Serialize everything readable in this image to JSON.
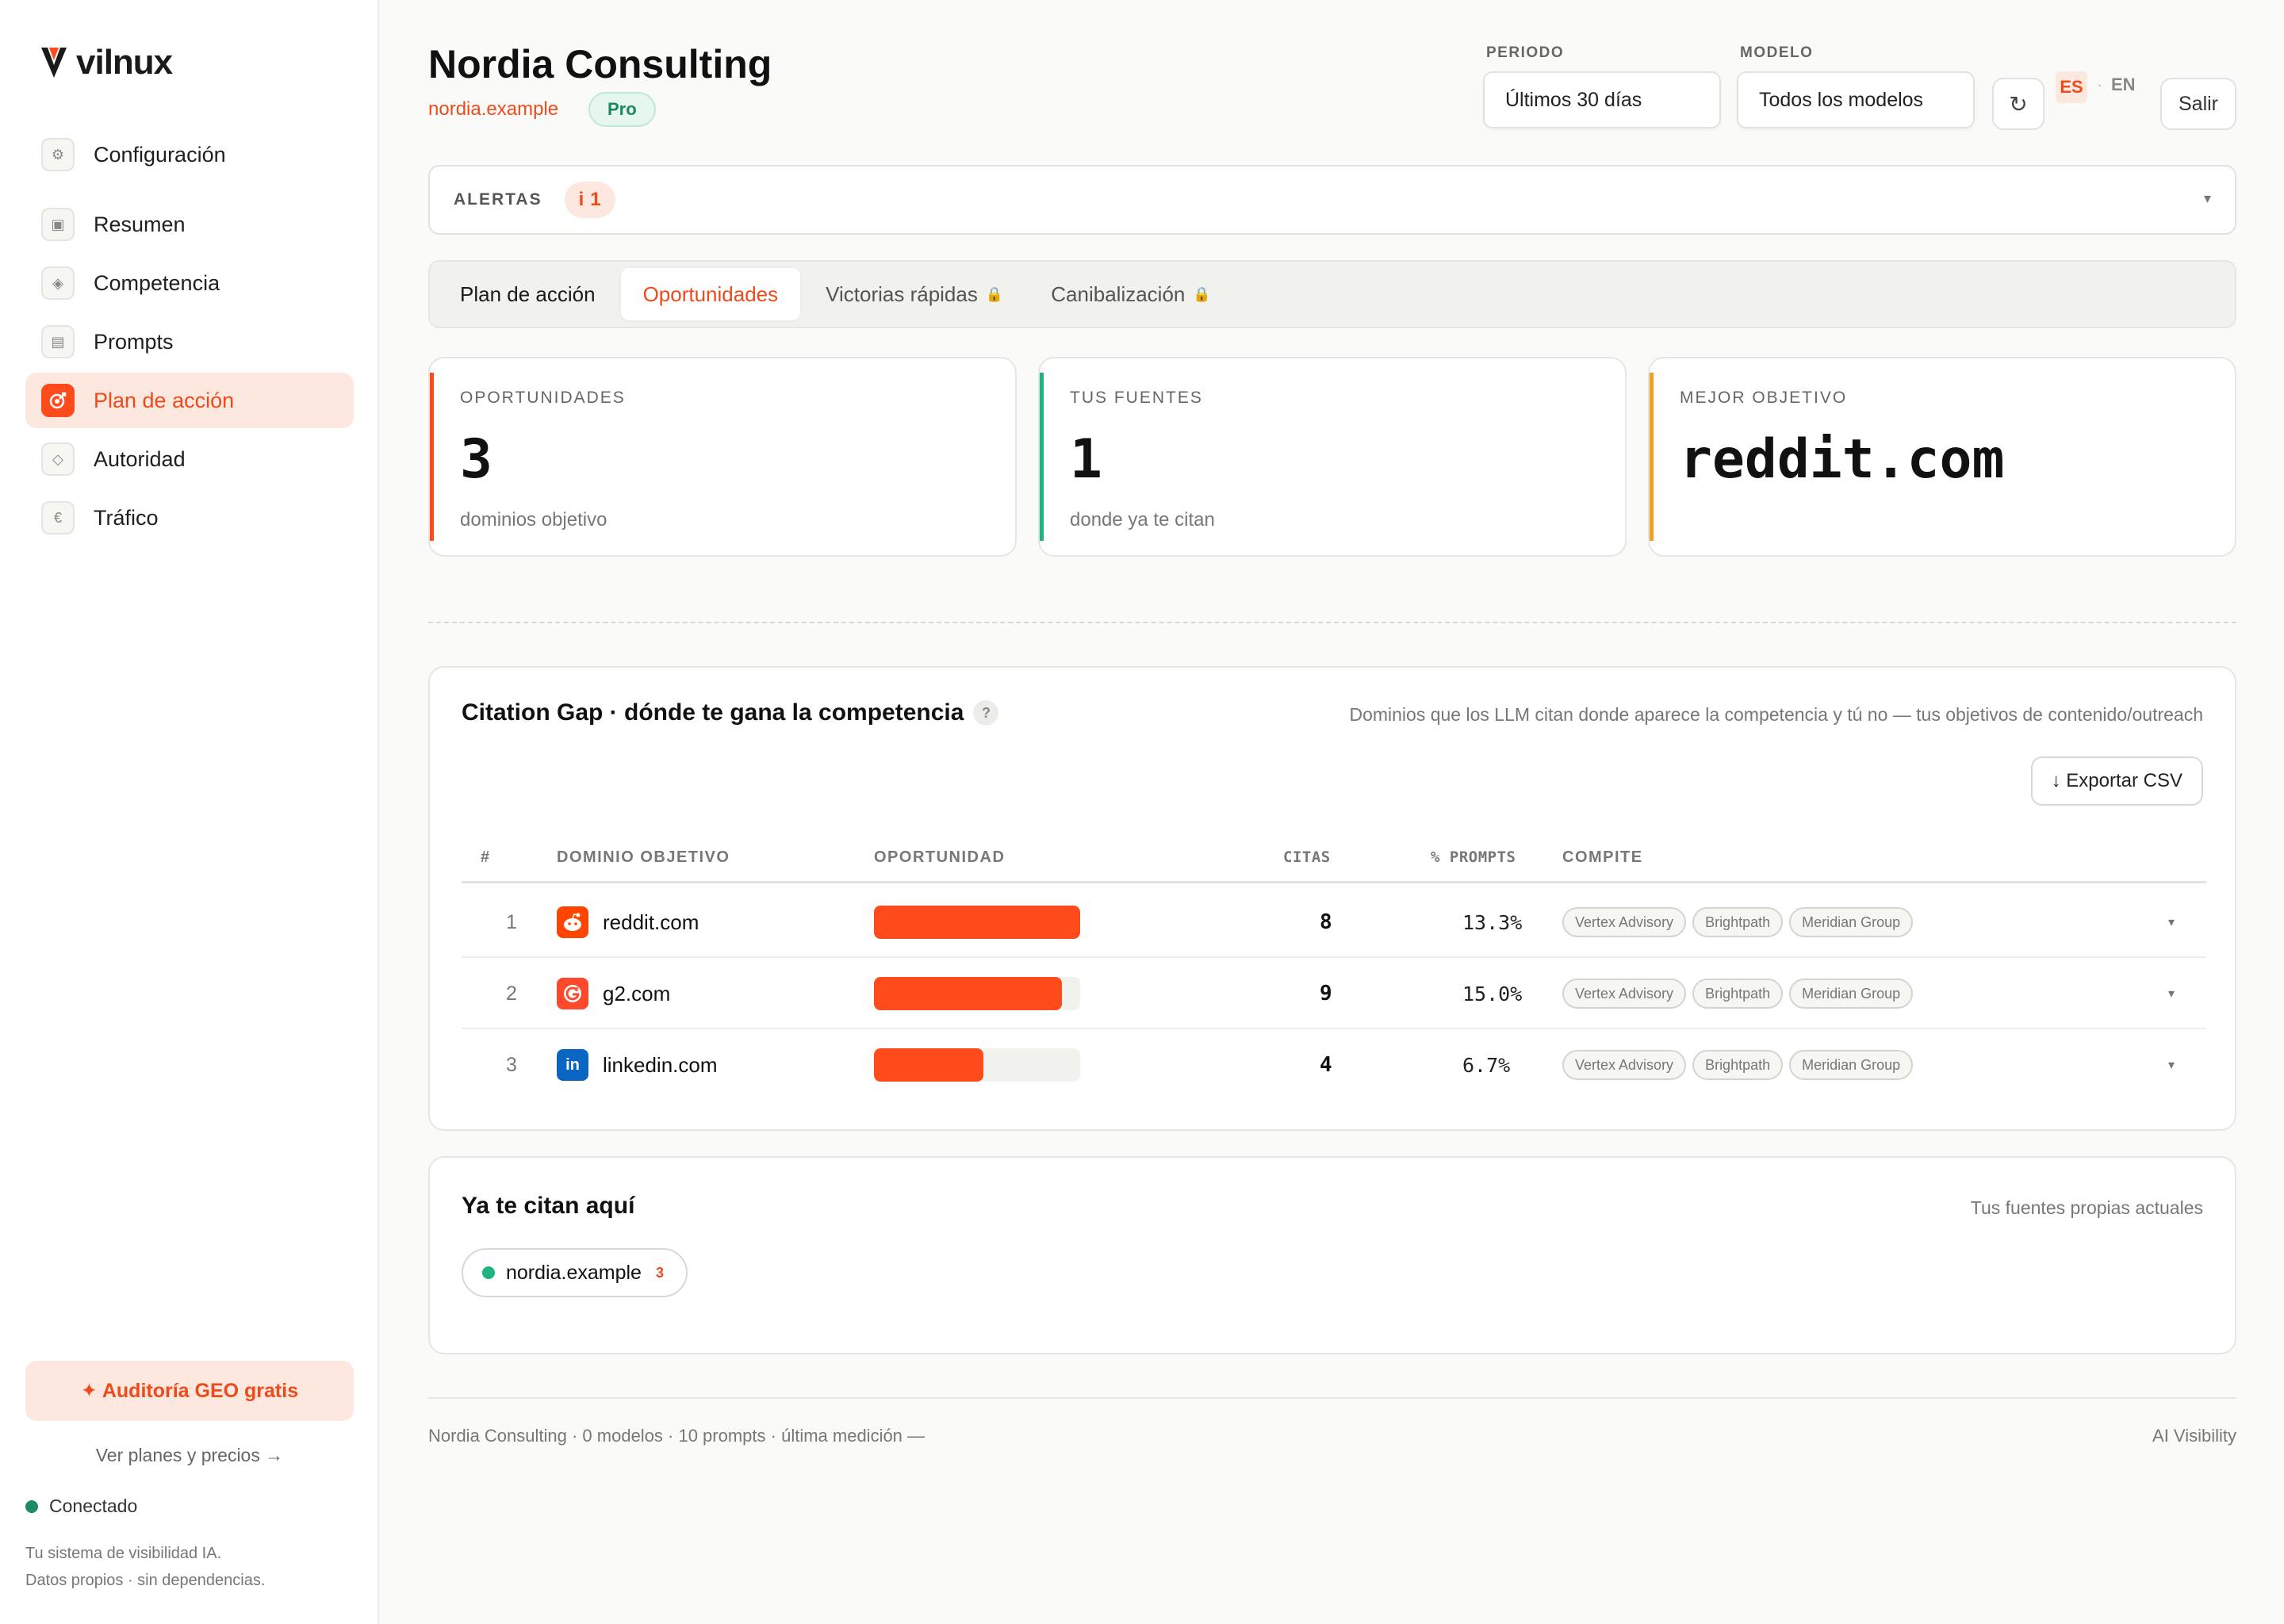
{
  "brand": {
    "logo_text": "vilnux"
  },
  "sidebar": {
    "items": [
      {
        "label": "Configuración",
        "icon": "gear-icon"
      },
      {
        "label": "Resumen",
        "icon": "summary-icon"
      },
      {
        "label": "Competencia",
        "icon": "diamond-icon"
      },
      {
        "label": "Prompts",
        "icon": "list-icon"
      },
      {
        "label": "Plan de acción",
        "icon": "target-icon",
        "active": true
      },
      {
        "label": "Autoridad",
        "icon": "diamond-outline-icon"
      },
      {
        "label": "Tráfico",
        "icon": "euro-icon"
      }
    ],
    "audit_button": "✦ Auditoría GEO gratis",
    "plans_link": "Ver planes y precios →",
    "status": "Conectado",
    "tagline_1": "Tu sistema de visibilidad IA.",
    "tagline_2": "Datos propios · sin dependencias."
  },
  "header": {
    "title": "Nordia Consulting",
    "domain": "nordia.example",
    "plan_badge": "Pro",
    "period_label": "PERIODO",
    "period_value": "Últimos 30 días",
    "model_label": "MODELO",
    "model_value": "Todos los modelos",
    "refresh": "↻",
    "lang_es": "ES",
    "lang_sep": "·",
    "lang_en": "EN",
    "logout": "Salir"
  },
  "alerts": {
    "label": "ALERTAS",
    "icon": "i",
    "count": "1",
    "caret": "▾"
  },
  "tabs": [
    {
      "label": "Plan de acción"
    },
    {
      "label": "Oportunidades",
      "active": true
    },
    {
      "label": "Victorias rápidas",
      "locked": true
    },
    {
      "label": "Canibalización",
      "locked": true
    }
  ],
  "lock_glyph": "🔒",
  "stats": [
    {
      "label": "OPORTUNIDADES",
      "value": "3",
      "sub": "dominios objetivo",
      "accent": "#ff4a1c"
    },
    {
      "label": "TUS FUENTES",
      "value": "1",
      "sub": "donde ya te citan",
      "accent": "#1fb37e"
    },
    {
      "label": "MEJOR OBJETIVO",
      "value": "reddit.com",
      "sub": "",
      "accent": "#f0a020"
    }
  ],
  "citation_gap": {
    "title": "Citation Gap · dónde te gana la competencia",
    "help": "?",
    "description": "Dominios que los LLM citan donde aparece la competencia y tú no — tus objetivos de contenido/outreach",
    "export": "↓ Exportar CSV",
    "columns": {
      "rank": "#",
      "domain": "DOMINIO OBJETIVO",
      "opportunity": "OPORTUNIDAD",
      "citations": "CITAS",
      "prompts": "% PROMPTS",
      "competes": "COMPITE"
    },
    "rows": [
      {
        "rank": "1",
        "domain": "reddit.com",
        "icon": "reddit-icon",
        "icon_glyph": "●",
        "icon_color": "#ff4500",
        "opportunity": 1.0,
        "citations": "8",
        "prompts": "13.3%",
        "competitors": [
          "Vertex Advisory",
          "Brightpath",
          "Meridian Group"
        ]
      },
      {
        "rank": "2",
        "domain": "g2.com",
        "icon": "g2-icon",
        "icon_glyph": "G",
        "icon_color": "#ff492c",
        "opportunity": 0.91,
        "citations": "9",
        "prompts": "15.0%",
        "competitors": [
          "Vertex Advisory",
          "Brightpath",
          "Meridian Group"
        ]
      },
      {
        "rank": "3",
        "domain": "linkedin.com",
        "icon": "linkedin-icon",
        "icon_glyph": "in",
        "icon_color": "#0a66c2",
        "opportunity": 0.53,
        "citations": "4",
        "prompts": "6.7%",
        "competitors": [
          "Vertex Advisory",
          "Brightpath",
          "Meridian Group"
        ]
      }
    ],
    "row_caret": "▾"
  },
  "cited_here": {
    "title": "Ya te citan aquí",
    "description": "Tus fuentes propias actuales",
    "source": {
      "domain": "nordia.example",
      "count": "3"
    }
  },
  "footer": {
    "left": "Nordia Consulting · 0 modelos · 10 prompts · última medición —",
    "right": "AI Visibility"
  },
  "colors": {
    "accent": "#ff4a1c",
    "accent_soft": "#fde8df",
    "success": "#1fb37e"
  }
}
